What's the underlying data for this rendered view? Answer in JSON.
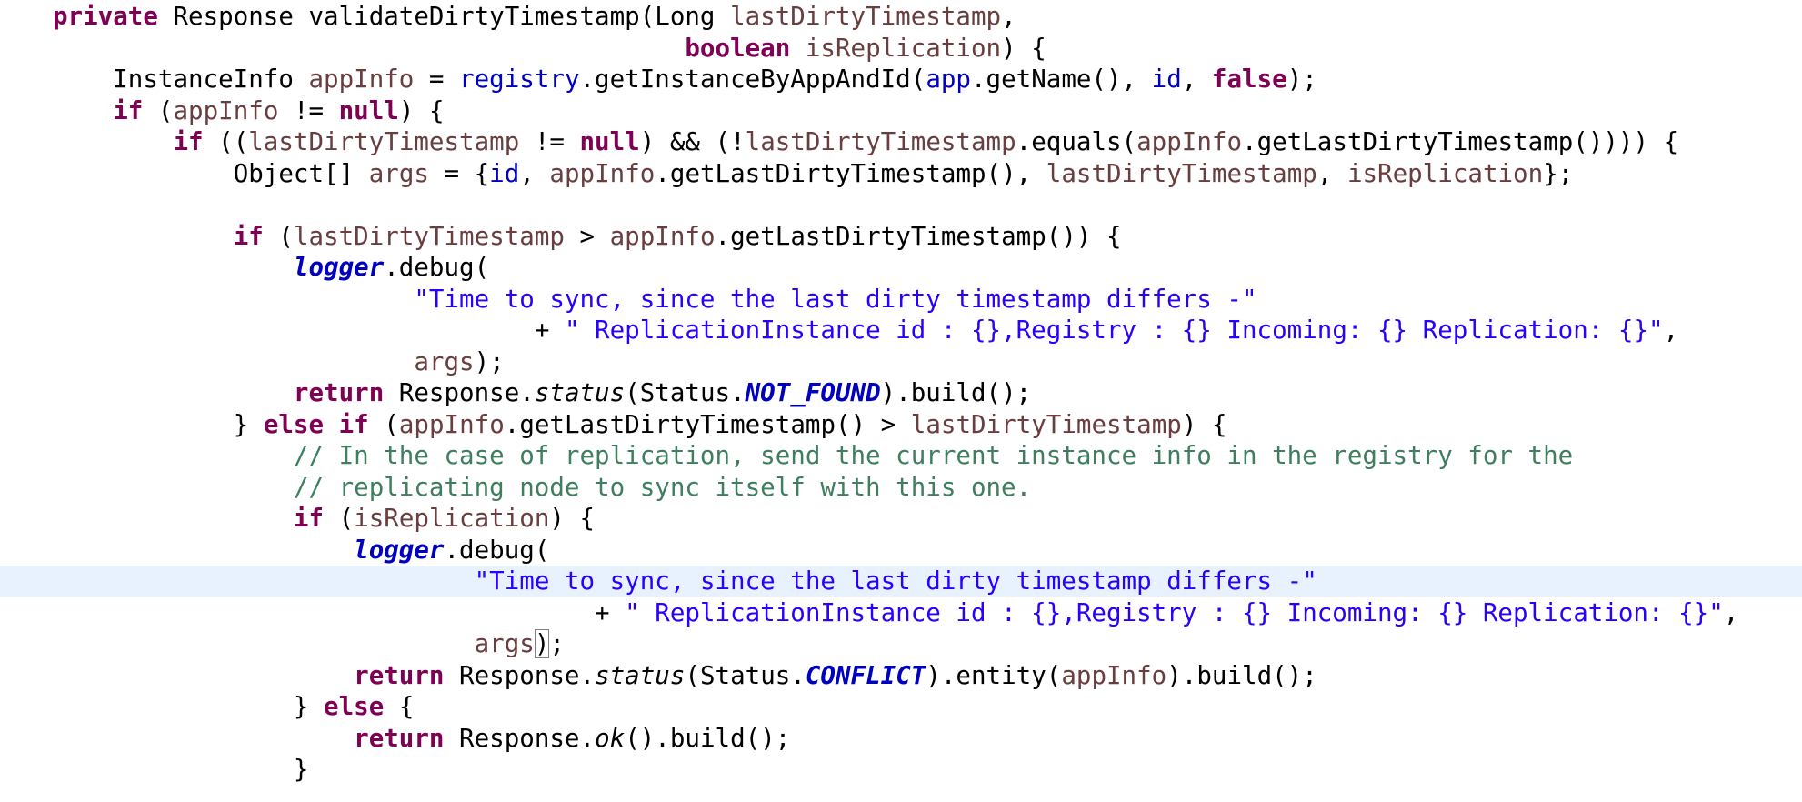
{
  "editor": {
    "language": "java",
    "colors": {
      "background": "#ffffff",
      "keyword": "#7f0055",
      "field": "#0000c0",
      "string": "#2a00ff",
      "comment": "#3f7f5f",
      "local_variable": "#6a3e3e",
      "default_text": "#000000",
      "current_line_highlight": "#e8f2fe"
    },
    "current_line": 18,
    "matched_bracket": {
      "line": 21,
      "char": ")"
    },
    "lines": [
      {
        "indent": 0,
        "tokens": [
          {
            "t": "private",
            "c": "kw"
          },
          {
            "t": " Response validateDirtyTimestamp(Long "
          },
          {
            "t": "lastDirtyTimestamp",
            "c": "var"
          },
          {
            "t": ","
          }
        ]
      },
      {
        "indent": 0,
        "tokens": [
          {
            "t": "                                          "
          },
          {
            "t": "boolean",
            "c": "kw"
          },
          {
            "t": " "
          },
          {
            "t": "isReplication",
            "c": "var"
          },
          {
            "t": ") {"
          }
        ]
      },
      {
        "indent": 4,
        "tokens": [
          {
            "t": "InstanceInfo "
          },
          {
            "t": "appInfo",
            "c": "var"
          },
          {
            "t": " = "
          },
          {
            "t": "registry",
            "c": "fld"
          },
          {
            "t": ".getInstanceByAppAndId("
          },
          {
            "t": "app",
            "c": "fld"
          },
          {
            "t": ".getName(), "
          },
          {
            "t": "id",
            "c": "fld"
          },
          {
            "t": ", "
          },
          {
            "t": "false",
            "c": "kw"
          },
          {
            "t": ");"
          }
        ]
      },
      {
        "indent": 4,
        "tokens": [
          {
            "t": "if",
            "c": "kw"
          },
          {
            "t": " ("
          },
          {
            "t": "appInfo",
            "c": "var"
          },
          {
            "t": " != "
          },
          {
            "t": "null",
            "c": "kw"
          },
          {
            "t": ") {"
          }
        ]
      },
      {
        "indent": 8,
        "tokens": [
          {
            "t": "if",
            "c": "kw"
          },
          {
            "t": " (("
          },
          {
            "t": "lastDirtyTimestamp",
            "c": "var"
          },
          {
            "t": " != "
          },
          {
            "t": "null",
            "c": "kw"
          },
          {
            "t": ") && (!"
          },
          {
            "t": "lastDirtyTimestamp",
            "c": "var"
          },
          {
            "t": ".equals("
          },
          {
            "t": "appInfo",
            "c": "var"
          },
          {
            "t": ".getLastDirtyTimestamp()))) {"
          }
        ]
      },
      {
        "indent": 12,
        "tokens": [
          {
            "t": "Object[] "
          },
          {
            "t": "args",
            "c": "var"
          },
          {
            "t": " = {"
          },
          {
            "t": "id",
            "c": "fld"
          },
          {
            "t": ", "
          },
          {
            "t": "appInfo",
            "c": "var"
          },
          {
            "t": ".getLastDirtyTimestamp(), "
          },
          {
            "t": "lastDirtyTimestamp",
            "c": "var"
          },
          {
            "t": ", "
          },
          {
            "t": "isReplication",
            "c": "var"
          },
          {
            "t": "};"
          }
        ]
      },
      {
        "indent": 0,
        "tokens": []
      },
      {
        "indent": 12,
        "tokens": [
          {
            "t": "if",
            "c": "kw"
          },
          {
            "t": " ("
          },
          {
            "t": "lastDirtyTimestamp",
            "c": "var"
          },
          {
            "t": " > "
          },
          {
            "t": "appInfo",
            "c": "var"
          },
          {
            "t": ".getLastDirtyTimestamp()) {"
          }
        ]
      },
      {
        "indent": 16,
        "tokens": [
          {
            "t": "logger",
            "c": "sfld"
          },
          {
            "t": ".debug("
          }
        ]
      },
      {
        "indent": 24,
        "tokens": [
          {
            "t": "\"Time to sync, since the last dirty timestamp differs -\"",
            "c": "str"
          }
        ]
      },
      {
        "indent": 32,
        "tokens": [
          {
            "t": "+ "
          },
          {
            "t": "\" ReplicationInstance id : {},Registry : {} Incoming: {} Replication: {}\"",
            "c": "str"
          },
          {
            "t": ","
          }
        ]
      },
      {
        "indent": 24,
        "tokens": [
          {
            "t": "args",
            "c": "var"
          },
          {
            "t": ");"
          }
        ]
      },
      {
        "indent": 16,
        "tokens": [
          {
            "t": "return",
            "c": "kw"
          },
          {
            "t": " Response."
          },
          {
            "t": "status",
            "c": "smeth"
          },
          {
            "t": "(Status."
          },
          {
            "t": "NOT_FOUND",
            "c": "sfld"
          },
          {
            "t": ").build();"
          }
        ]
      },
      {
        "indent": 12,
        "tokens": [
          {
            "t": "} "
          },
          {
            "t": "else",
            "c": "kw"
          },
          {
            "t": " "
          },
          {
            "t": "if",
            "c": "kw"
          },
          {
            "t": " ("
          },
          {
            "t": "appInfo",
            "c": "var"
          },
          {
            "t": ".getLastDirtyTimestamp() > "
          },
          {
            "t": "lastDirtyTimestamp",
            "c": "var"
          },
          {
            "t": ") {"
          }
        ]
      },
      {
        "indent": 16,
        "tokens": [
          {
            "t": "// In the case of replication, send the current instance info in the registry for the",
            "c": "cmt"
          }
        ]
      },
      {
        "indent": 16,
        "tokens": [
          {
            "t": "// replicating node to sync itself with this one.",
            "c": "cmt"
          }
        ]
      },
      {
        "indent": 16,
        "tokens": [
          {
            "t": "if",
            "c": "kw"
          },
          {
            "t": " ("
          },
          {
            "t": "isReplication",
            "c": "var"
          },
          {
            "t": ") {"
          }
        ]
      },
      {
        "indent": 20,
        "tokens": [
          {
            "t": "logger",
            "c": "sfld"
          },
          {
            "t": ".debug("
          }
        ]
      },
      {
        "indent": 28,
        "tokens": [
          {
            "t": "\"Time to sync, since the last dirty timestamp differs -\"",
            "c": "str"
          }
        ]
      },
      {
        "indent": 36,
        "tokens": [
          {
            "t": "+ "
          },
          {
            "t": "\" ReplicationInstance id : {},Registry : {} Incoming: {} Replication: {}\"",
            "c": "str"
          },
          {
            "t": ","
          }
        ]
      },
      {
        "indent": 28,
        "tokens": [
          {
            "t": "args",
            "c": "var"
          },
          {
            "t": ")",
            "c": "bracket-match"
          },
          {
            "t": ";"
          }
        ]
      },
      {
        "indent": 20,
        "tokens": [
          {
            "t": "return",
            "c": "kw"
          },
          {
            "t": " Response."
          },
          {
            "t": "status",
            "c": "smeth"
          },
          {
            "t": "(Status."
          },
          {
            "t": "CONFLICT",
            "c": "sfld"
          },
          {
            "t": ").entity("
          },
          {
            "t": "appInfo",
            "c": "var"
          },
          {
            "t": ").build();"
          }
        ]
      },
      {
        "indent": 16,
        "tokens": [
          {
            "t": "} "
          },
          {
            "t": "else",
            "c": "kw"
          },
          {
            "t": " {"
          }
        ]
      },
      {
        "indent": 20,
        "tokens": [
          {
            "t": "return",
            "c": "kw"
          },
          {
            "t": " Response."
          },
          {
            "t": "ok",
            "c": "smeth"
          },
          {
            "t": "().build();"
          }
        ]
      },
      {
        "indent": 16,
        "tokens": [
          {
            "t": "}"
          }
        ]
      }
    ]
  }
}
